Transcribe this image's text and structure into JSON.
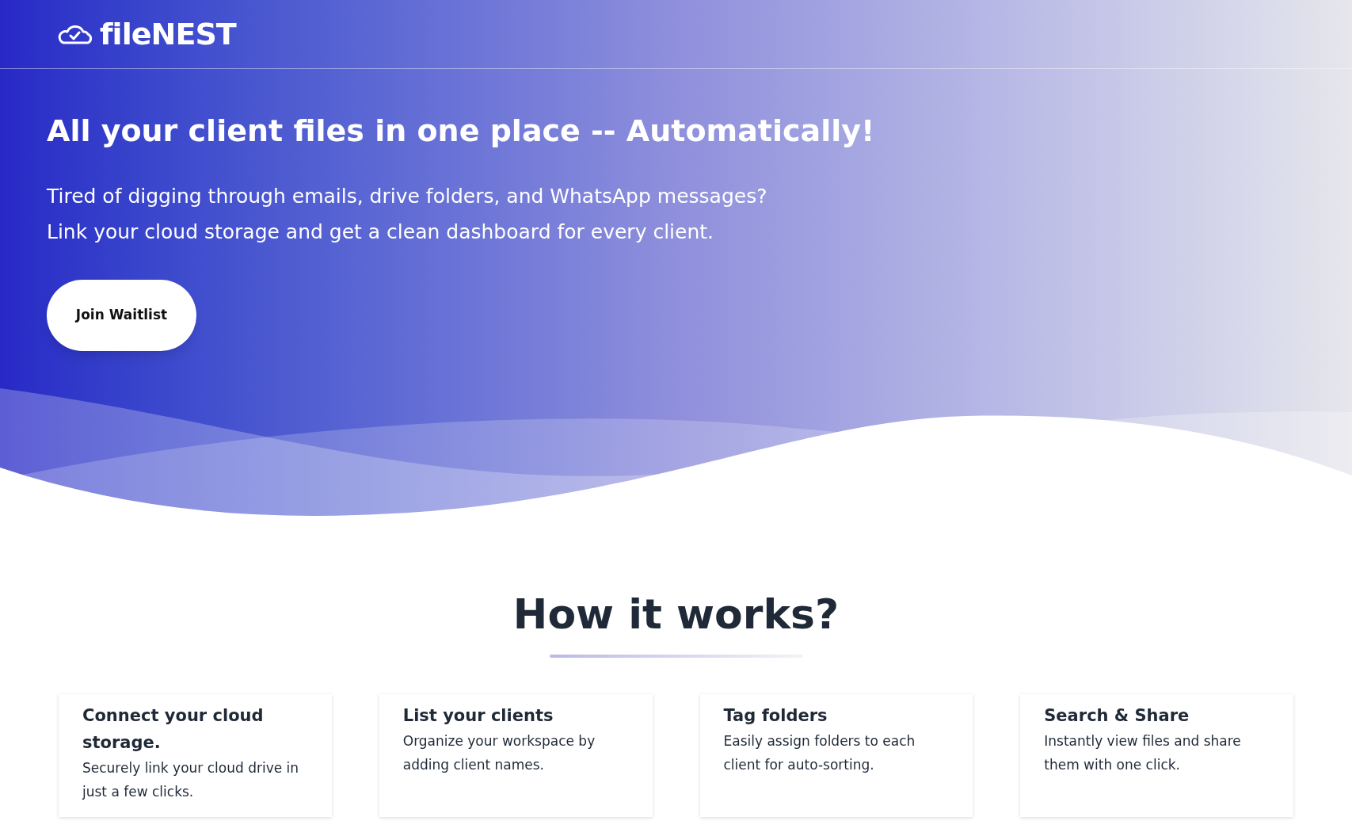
{
  "header": {
    "logo": "fileNEST"
  },
  "hero": {
    "title": "All your client files in one place -- Automatically!",
    "lines": [
      "Tired of digging through emails, drive folders, and WhatsApp messages?",
      "Link your cloud storage and get a clean dashboard for every client."
    ],
    "button": "Join Waitlist"
  },
  "how": {
    "title": "How it works?",
    "steps": [
      {
        "title": "Connect your cloud storage.",
        "text": "Securely link your cloud drive in just a few clicks."
      },
      {
        "title": "List your clients",
        "text": "Organize your workspace by adding client names."
      },
      {
        "title": "Tag folders",
        "text": "Easily assign folders to each client for auto-sorting."
      },
      {
        "title": "Search & Share",
        "text": "Instantly view files and share them with one click."
      }
    ]
  }
}
